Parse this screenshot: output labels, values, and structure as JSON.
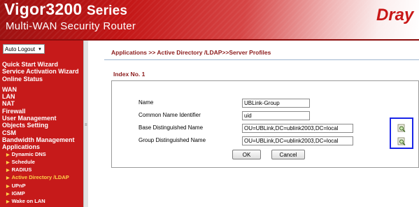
{
  "header": {
    "brand": "Vigor3200",
    "series": "Series",
    "subtitle": "Multi-WAN Security Router",
    "logo": "Dray"
  },
  "sidebar": {
    "auto_logout": "Auto Logout",
    "nav": [
      {
        "label": "Quick Start Wizard"
      },
      {
        "label": "Service Activation Wizard"
      },
      {
        "label": "Online Status"
      },
      {
        "label": "WAN"
      },
      {
        "label": "LAN"
      },
      {
        "label": "NAT"
      },
      {
        "label": "Firewall"
      },
      {
        "label": "User Management"
      },
      {
        "label": "Objects Setting"
      },
      {
        "label": "CSM"
      },
      {
        "label": "Bandwidth Management"
      },
      {
        "label": "Applications"
      },
      {
        "label": "Dynamic DNS"
      },
      {
        "label": "Schedule"
      },
      {
        "label": "RADIUS"
      },
      {
        "label": "Active Directory /LDAP"
      },
      {
        "label": "UPnP"
      },
      {
        "label": "IGMP"
      },
      {
        "label": "Wake on LAN"
      }
    ]
  },
  "content": {
    "breadcrumb": "Applications >> Active Directory /LDAP>>Server Profiles",
    "index_title": "Index No. 1",
    "fields": {
      "name": {
        "label": "Name",
        "value": "UBLink-Group"
      },
      "cn": {
        "label": "Common Name Identifier",
        "value": "uid"
      },
      "base_dn": {
        "label": "Base Distinguished Name",
        "value": "OU=UBLink,DC=ublink2003,DC=local"
      },
      "group_dn": {
        "label": "Group Distinguished Name",
        "value": "OU=UBLink,DC=ublink2003,DC=local"
      }
    },
    "ok_label": "OK",
    "cancel_label": "Cancel"
  },
  "colors": {
    "sidebar_bg": "#c61a1a",
    "title_red": "#8b1a1a",
    "active_item": "#ffd24a",
    "highlight_box": "#1a26e8"
  }
}
